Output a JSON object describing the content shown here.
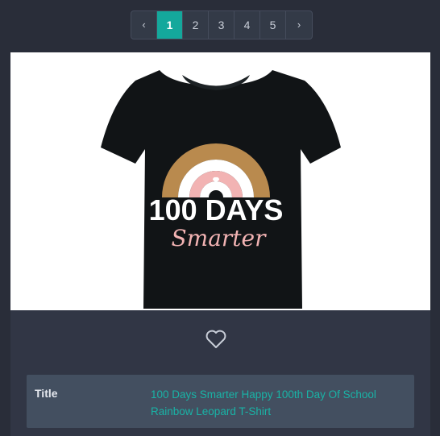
{
  "pagination": {
    "prev_label": "‹",
    "next_label": "›",
    "pages": [
      "1",
      "2",
      "3",
      "4",
      "5"
    ],
    "active_page": "1"
  },
  "product": {
    "image_alt": "100 Days Smarter Happy 100th Day Of School Rainbow Leopard T-Shirt",
    "shirt_text_main": "100 DAYS",
    "shirt_text_script": "Smarter",
    "favorite_icon": "heart-outline-icon"
  },
  "details": {
    "title_label": "Title",
    "title_value": "100 Days Smarter Happy 100th Day Of School Rainbow Leopard T-Shirt"
  },
  "colors": {
    "background": "#292d39",
    "card": "#313645",
    "accent": "#14a89c",
    "detail_row": "#434f60"
  }
}
